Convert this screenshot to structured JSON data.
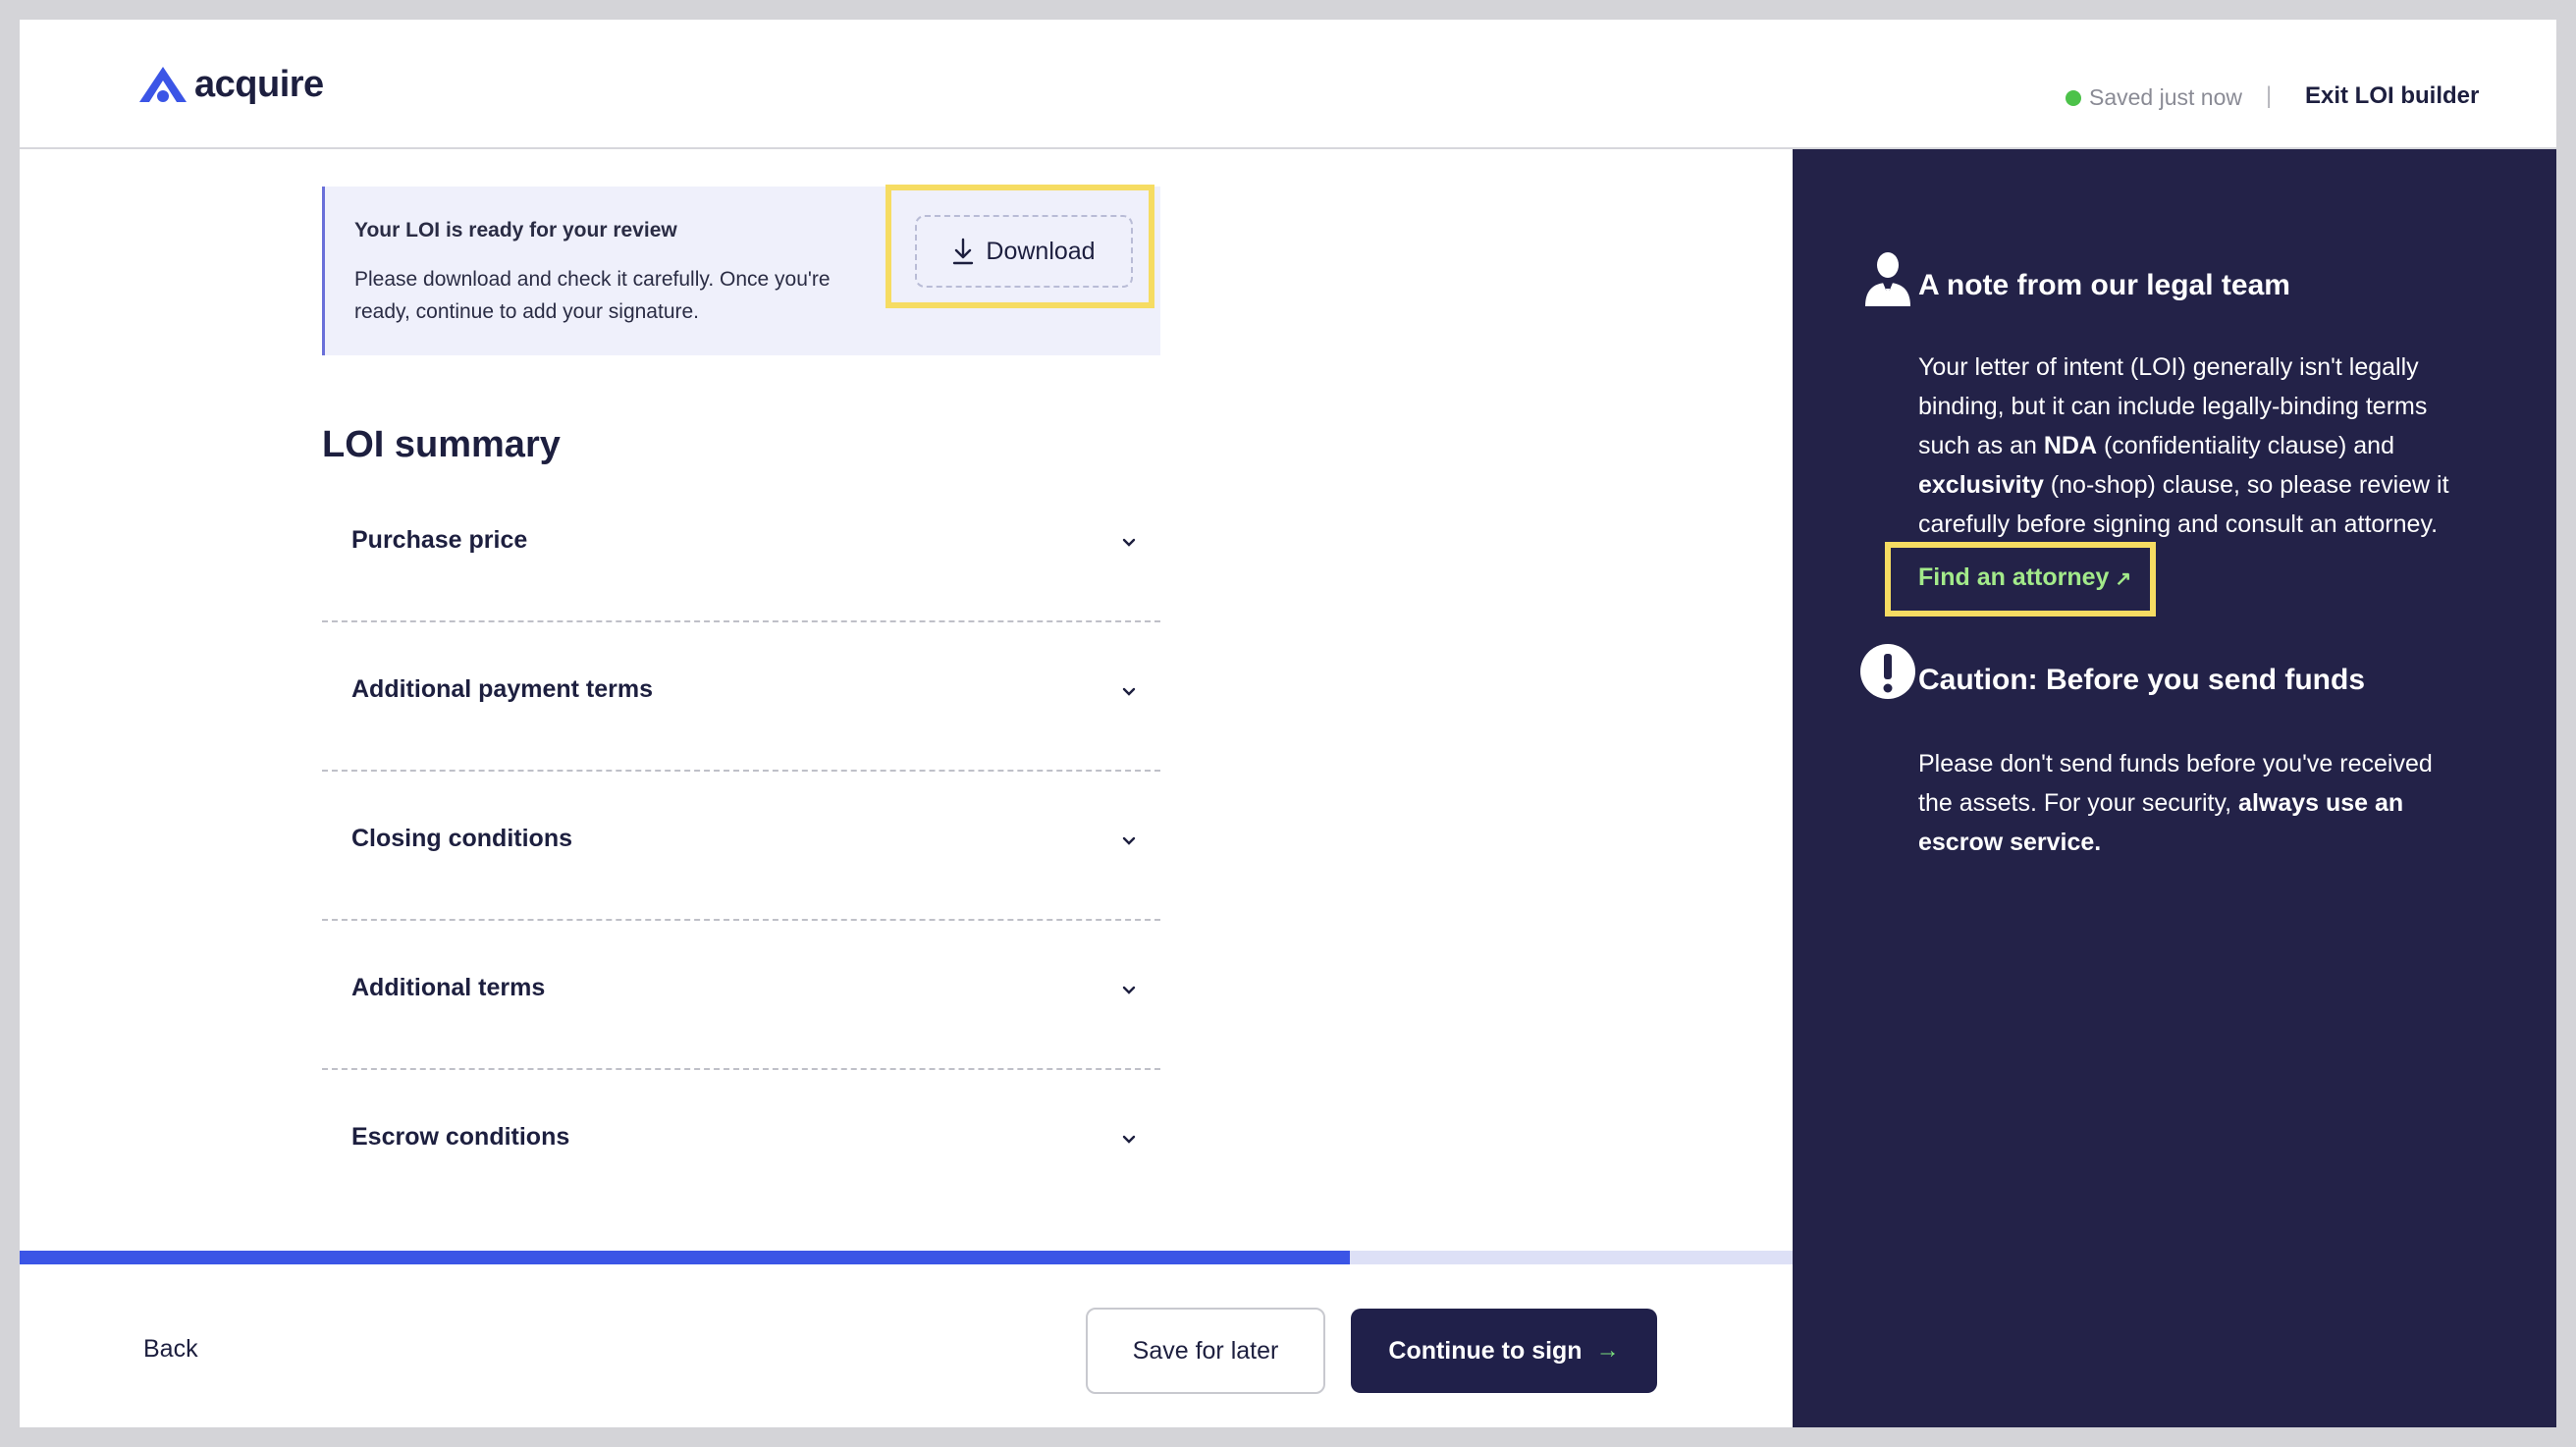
{
  "header": {
    "logo_text": "acquire",
    "save_status": "Saved just now",
    "separator": "|",
    "exit_label": "Exit LOI builder"
  },
  "notice": {
    "title": "Your LOI is ready for your review",
    "body": "Please download and check it carefully. Once you're ready, continue to add your signature.",
    "download_label": "Download"
  },
  "summary": {
    "title": "LOI summary",
    "items": [
      {
        "label": "Purchase price"
      },
      {
        "label": "Additional payment terms"
      },
      {
        "label": "Closing conditions"
      },
      {
        "label": "Additional terms"
      },
      {
        "label": "Escrow conditions"
      }
    ]
  },
  "progress": {
    "percent": 75
  },
  "footer": {
    "back_label": "Back",
    "save_later_label": "Save for later",
    "continue_label": "Continue to sign",
    "continue_arrow": "→"
  },
  "sidebar": {
    "legal": {
      "title": "A note from our legal team",
      "body_1": "Your letter of intent (LOI) generally isn't legally binding, but it can include legally-binding terms such as an ",
      "bold_1": "NDA",
      "body_2": " (confidentiality clause) and ",
      "bold_2": "exclusivity",
      "body_3": " (no-shop) clause, so please review it carefully before signing and consult an attorney.",
      "link_label": "Find an attorney",
      "link_icon": "↗"
    },
    "caution": {
      "title": "Caution: Before you send funds",
      "body_1": "Please don't send funds before you've received the assets. For your security, ",
      "bold_1": "always use an escrow service."
    }
  },
  "colors": {
    "brand": "#3b55e6",
    "dark": "#232248",
    "highlight": "#f6dc62",
    "link_green": "#a3ea8a",
    "status_green": "#4cc24a"
  }
}
